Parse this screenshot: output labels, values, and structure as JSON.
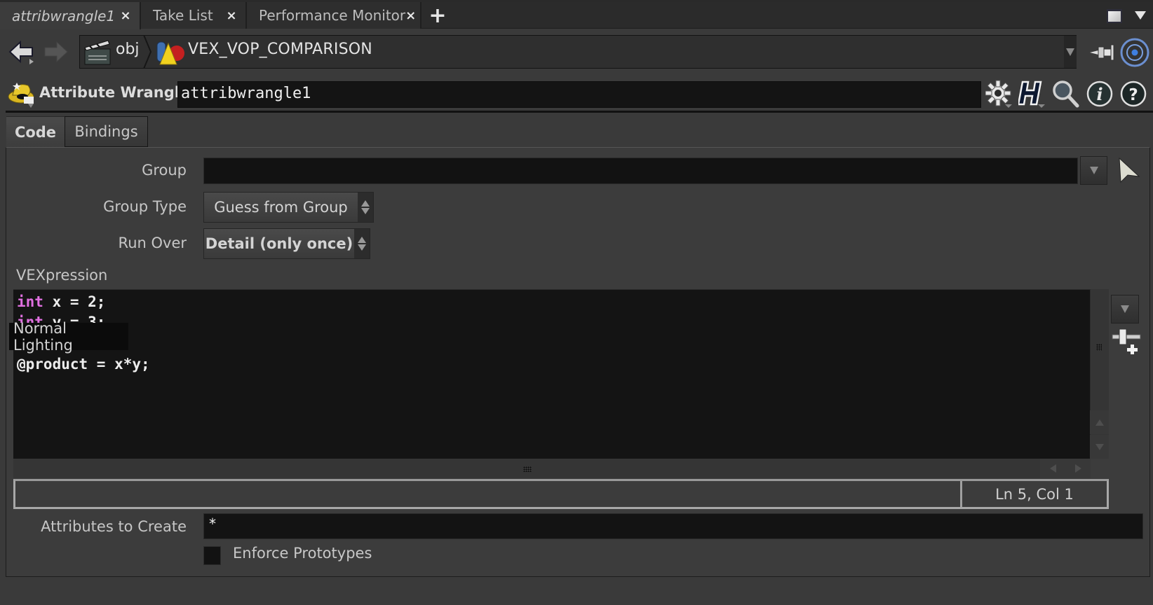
{
  "tabs": [
    {
      "label": "attribwrangle1",
      "active": true
    },
    {
      "label": "Take List",
      "active": false
    },
    {
      "label": "Performance Monitor",
      "active": false
    }
  ],
  "tab_close_glyph": "×",
  "tab_add_glyph": "+",
  "breadcrumb": {
    "items": [
      {
        "label": "obj",
        "icon": "clapperboard-icon"
      },
      {
        "label": "VEX_VOP_COMPARISON",
        "icon": "geometry-network-icon"
      }
    ]
  },
  "node": {
    "type_label": "Attribute Wrangle",
    "name": "attribwrangle1",
    "icon": "wrangler-hat-icon"
  },
  "header_icons": [
    "gear-icon",
    "houdini-h-icon",
    "search-icon",
    "info-icon",
    "help-icon"
  ],
  "parm_tabs": [
    {
      "label": "Code",
      "active": true
    },
    {
      "label": "Bindings",
      "active": false
    }
  ],
  "parms": {
    "group": {
      "label": "Group",
      "value": ""
    },
    "group_type": {
      "label": "Group Type",
      "value": "Guess from Group"
    },
    "run_over": {
      "label": "Run Over",
      "value": "Detail (only once)"
    },
    "vexpression": {
      "label": "VEXpression",
      "lines": [
        {
          "keyword": "int",
          "rest": " x = 2;"
        },
        {
          "keyword": "int",
          "rest": " y = 3;"
        },
        {
          "keyword": "",
          "rest": ""
        },
        {
          "keyword": "",
          "rest": "@product = x*y;"
        }
      ]
    },
    "cursor_position": "Ln 5, Col 1",
    "attributes_to_create": {
      "label": "Attributes to Create",
      "value": "*"
    },
    "enforce_prototypes": {
      "label": "Enforce Prototypes",
      "checked": false
    }
  },
  "tooltip": "Normal Lighting",
  "colors": {
    "keyword": "#e070e0",
    "background": "#3a3a3a",
    "editor_bg": "#141414"
  }
}
